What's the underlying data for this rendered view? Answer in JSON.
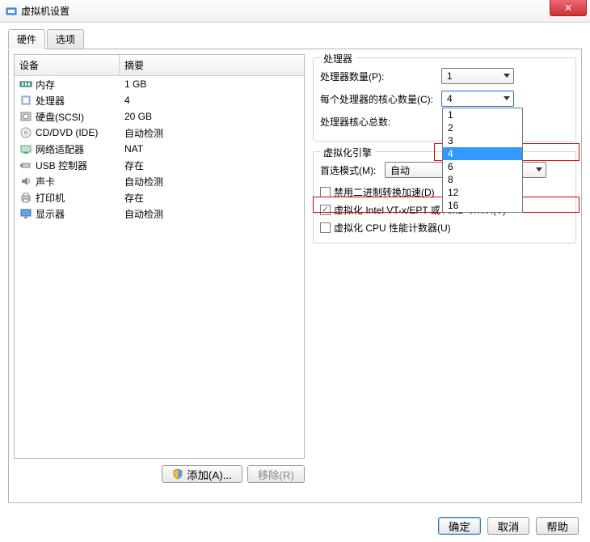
{
  "window": {
    "title": "虚拟机设置",
    "close": "✕"
  },
  "tabs": {
    "hardware": "硬件",
    "options": "选项"
  },
  "table_header": {
    "device": "设备",
    "summary": "摘要"
  },
  "devices": [
    {
      "icon": "memory-icon",
      "name": "内存",
      "summary": "1 GB"
    },
    {
      "icon": "cpu-icon",
      "name": "处理器",
      "summary": "4"
    },
    {
      "icon": "disk-icon",
      "name": "硬盘(SCSI)",
      "summary": "20 GB"
    },
    {
      "icon": "cd-icon",
      "name": "CD/DVD (IDE)",
      "summary": "自动检测"
    },
    {
      "icon": "net-icon",
      "name": "网络适配器",
      "summary": "NAT"
    },
    {
      "icon": "usb-icon",
      "name": "USB 控制器",
      "summary": "存在"
    },
    {
      "icon": "sound-icon",
      "name": "声卡",
      "summary": "自动检测"
    },
    {
      "icon": "printer-icon",
      "name": "打印机",
      "summary": "存在"
    },
    {
      "icon": "display-icon",
      "name": "显示器",
      "summary": "自动检测"
    }
  ],
  "buttons": {
    "add": "添加(A)...",
    "remove": "移除(R)",
    "ok": "确定",
    "cancel": "取消",
    "help": "帮助"
  },
  "processors_group": {
    "legend": "处理器",
    "count_label": "处理器数量(P):",
    "count_value": "1",
    "cores_label": "每个处理器的核心数量(C):",
    "cores_value": "4",
    "cores_options": [
      "1",
      "2",
      "3",
      "4",
      "6",
      "8",
      "12",
      "16"
    ],
    "cores_selected_index": 3,
    "total_label": "处理器核心总数:"
  },
  "engine_group": {
    "legend": "虚拟化引擎",
    "mode_label": "首选模式(M):",
    "mode_value": "自动",
    "chk_disable_bin": {
      "checked": false,
      "label": "禁用二进制转换加速(D)"
    },
    "chk_vt": {
      "checked": true,
      "label": "虚拟化 Intel VT-x/EPT 或 AMD-V/RVI(V)"
    },
    "chk_cpu_counter": {
      "checked": false,
      "label": "虚拟化 CPU 性能计数器(U)"
    }
  },
  "icon_svgs": {
    "memory-icon": "ram",
    "cpu-icon": "cpu",
    "disk-icon": "disk",
    "cd-icon": "cd",
    "net-icon": "net",
    "usb-icon": "usb",
    "sound-icon": "sound",
    "printer-icon": "printer",
    "display-icon": "display"
  },
  "chart_data": null
}
